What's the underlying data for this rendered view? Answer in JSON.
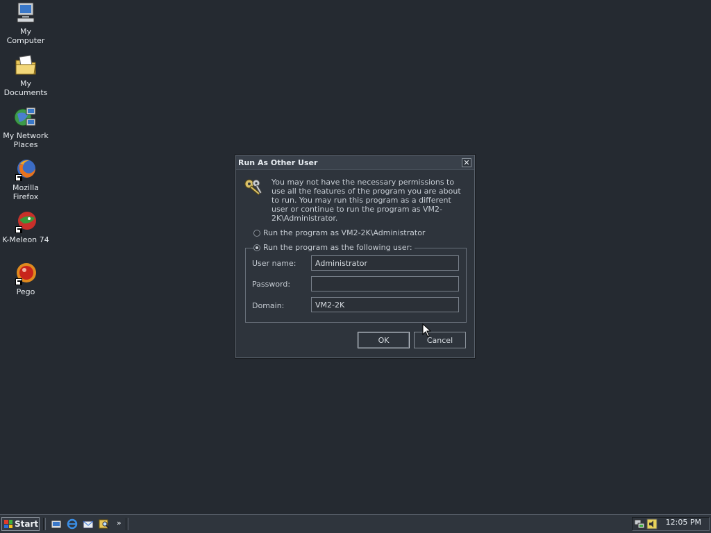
{
  "desktop": {
    "icons": [
      {
        "label": "My Computer",
        "icon": "computer-icon"
      },
      {
        "label": "My Documents",
        "icon": "documents-folder-icon"
      },
      {
        "label": "My Network Places",
        "icon": "network-places-icon"
      },
      {
        "label": "Mozilla Firefox",
        "icon": "firefox-icon"
      },
      {
        "label": "K-Meleon 74",
        "icon": "k-meleon-icon"
      },
      {
        "label": "Pego",
        "icon": "pego-icon"
      }
    ]
  },
  "dialog": {
    "title": "Run As Other User",
    "close_glyph": "✕",
    "message": "You may not have the necessary permissions to use all the features of the program you are about to run.  You may run this program as a different user or continue to run the program as VM2-2K\\Administrator.",
    "radio_current": {
      "label": "Run the program as VM2-2K\\Administrator",
      "checked": false
    },
    "radio_other": {
      "label": "Run the program as the following user:",
      "checked": true
    },
    "fields": {
      "username": {
        "label": "User name:",
        "value": "Administrator"
      },
      "password": {
        "label": "Password:",
        "value": ""
      },
      "domain": {
        "label": "Domain:",
        "value": "VM2-2K"
      }
    },
    "ok_label": "OK",
    "cancel_label": "Cancel"
  },
  "taskbar": {
    "start_label": "Start",
    "quick_launch": [
      "show-desktop-icon",
      "internet-explorer-icon",
      "outlook-express-icon",
      "search-icon"
    ],
    "overflow_glyph": "»",
    "tray_icons": [
      "network-tray-icon",
      "volume-tray-icon"
    ],
    "clock": "12:05 PM"
  },
  "colors": {
    "desktop_bg": "#252a31",
    "dialog_bg": "#2e343c",
    "text": "#c6ccd3"
  }
}
